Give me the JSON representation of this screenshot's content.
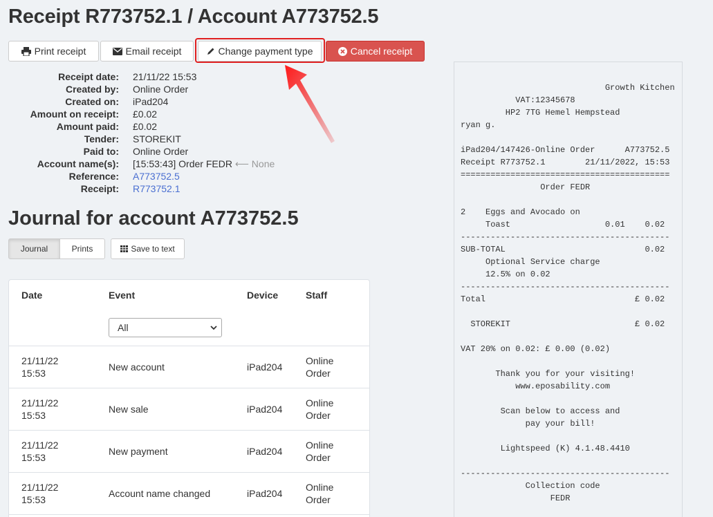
{
  "page": {
    "title": "Receipt R773752.1 / Account A773752.5"
  },
  "actions": {
    "print": "Print receipt",
    "email": "Email receipt",
    "change_payment": "Change payment type",
    "cancel": "Cancel receipt"
  },
  "details": [
    {
      "label": "Receipt date:",
      "value": "21/11/22 15:53"
    },
    {
      "label": "Created by:",
      "value": "Online Order"
    },
    {
      "label": "Created on:",
      "value": "iPad204"
    },
    {
      "label": "Amount on receipt:",
      "value": "£0.02"
    },
    {
      "label": "Amount paid:",
      "value": "£0.02"
    },
    {
      "label": "Tender:",
      "value": "STOREKIT"
    },
    {
      "label": "Paid to:",
      "value": "Online Order"
    },
    {
      "label": "Account name(s):",
      "value": "[15:53:43] Order FEDR",
      "suffix": "⟵ None"
    },
    {
      "label": "Reference:",
      "value": "A773752.5"
    },
    {
      "label": "Receipt:",
      "value": "R773752.1"
    }
  ],
  "journal": {
    "title": "Journal for account A773752.5",
    "tabs": [
      "Journal",
      "Prints"
    ],
    "save_label": "Save to text",
    "columns": [
      "Date",
      "Event",
      "Device",
      "Staff"
    ],
    "filter_selected": "All",
    "rows": [
      {
        "date": "21/11/22 15:53",
        "event": "New account",
        "device": "iPad204",
        "staff": "Online Order"
      },
      {
        "date": "21/11/22 15:53",
        "event": "New sale",
        "device": "iPad204",
        "staff": "Online Order"
      },
      {
        "date": "21/11/22 15:53",
        "event": "New payment",
        "device": "iPad204",
        "staff": "Online Order"
      },
      {
        "date": "21/11/22 15:53",
        "event": "Account name changed",
        "device": "iPad204",
        "staff": "Online Order"
      }
    ]
  },
  "receipt_text": "                             Growth Kitchen\n           VAT:12345678\n         HP2 7TG Hemel Hempstead\nryan g.\n\niPad204/147426-Online Order      A773752.5\nReceipt R773752.1        21/11/2022, 15:53\n==========================================\n                Order FEDR\n\n2    Eggs and Avocado on\n     Toast                   0.01    0.02\n------------------------------------------\nSUB-TOTAL                            0.02\n     Optional Service charge\n     12.5% on 0.02\n------------------------------------------\nTotal                              £ 0.02\n\n  STOREKIT                         £ 0.02\n\nVAT 20% on 0.02: £ 0.00 (0.02)\n\n       Thank you for your visiting!\n           www.eposability.com\n\n        Scan below to access and\n             pay your bill!\n\n        Lightspeed (K) 4.1.48.4410\n\n------------------------------------------\n             Collection code\n                  FEDR",
  "colors": {
    "cancel": "#d9534f",
    "link": "#4a6fd1",
    "highlight": "#e02020"
  }
}
